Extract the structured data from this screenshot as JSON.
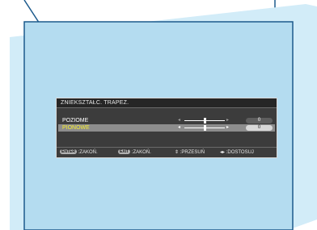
{
  "menu": {
    "title": "ZNIEKSZTAŁC. TRAPEZ.",
    "items": [
      {
        "label": "POZIOME",
        "value": "0",
        "level": 0.5,
        "selected": false
      },
      {
        "label": "PIONOWE",
        "value": "0",
        "level": 0.5,
        "selected": true
      }
    ],
    "arrow_left": "◂",
    "arrow_right": "▸"
  },
  "footer": {
    "enter_key": "ENTER",
    "enter_action": ":ZAKOŃ.",
    "exit_key": "EXIT",
    "exit_action": ":ZAKOŃ.",
    "move_glyph": "⇕",
    "move_action": ":PRZESUŃ",
    "adjust_glyph": "◂▸",
    "adjust_action": ":DOSTOSUJ"
  },
  "colors": {
    "screen_fill": "#b4dcf0",
    "screen_back": "#d2ecf8",
    "screen_outline": "#1c5a8c",
    "osd_panel": "#3c3c3c",
    "selected_text": "#f4ec30"
  }
}
